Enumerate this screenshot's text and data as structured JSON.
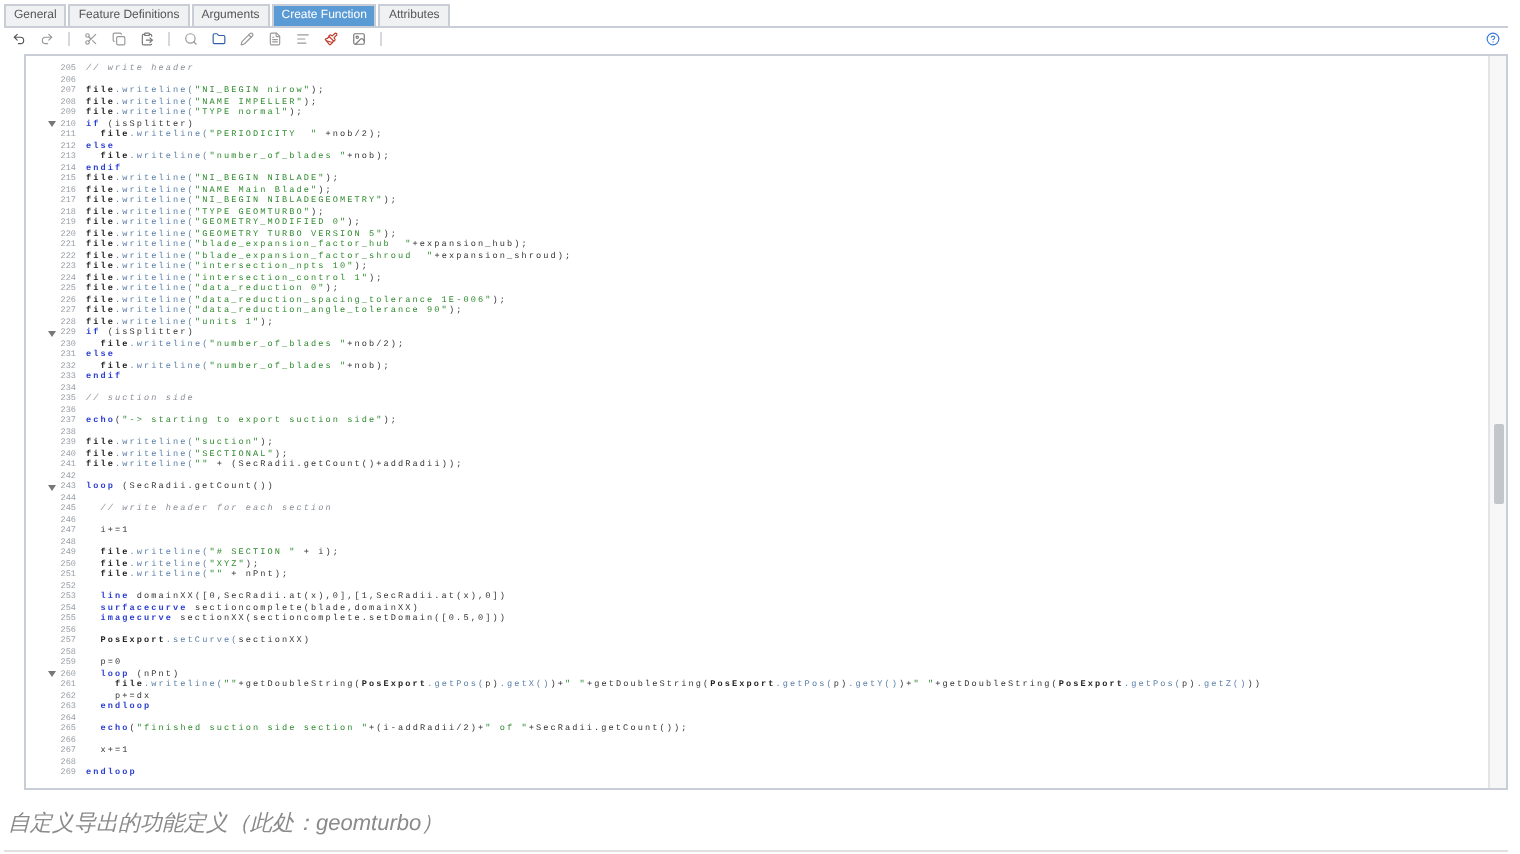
{
  "tabs": [
    {
      "label": "General",
      "selected": false
    },
    {
      "label": "Feature Definitions",
      "selected": false
    },
    {
      "label": "Arguments",
      "selected": false
    },
    {
      "label": "Create Function",
      "selected": true
    },
    {
      "label": "Attributes",
      "selected": false
    }
  ],
  "toolbar": [
    {
      "kind": "undo"
    },
    {
      "kind": "redo"
    },
    {
      "kind": "sep"
    },
    {
      "kind": "cut"
    },
    {
      "kind": "copy"
    },
    {
      "kind": "paste"
    },
    {
      "kind": "sep"
    },
    {
      "kind": "search"
    },
    {
      "kind": "folder"
    },
    {
      "kind": "pencil"
    },
    {
      "kind": "file"
    },
    {
      "kind": "list"
    },
    {
      "kind": "brush"
    },
    {
      "kind": "image"
    },
    {
      "kind": "sep"
    },
    {
      "kind": "help"
    }
  ],
  "editor": {
    "lines": [
      {
        "number": "205",
        "fold": false,
        "parts": [
          {
            "kind": "comment",
            "text": "// write header"
          }
        ]
      },
      {
        "number": "206",
        "fold": false
      },
      {
        "number": "207",
        "fold": false,
        "parts": [
          {
            "kind": "obj",
            "text": "file"
          },
          {
            "kind": "fn",
            "text": ".writeline("
          },
          {
            "kind": "str",
            "text": "\"NI_BEGIN nirow\""
          },
          {
            "kind": "plain",
            "text": ");"
          }
        ]
      },
      {
        "number": "208",
        "fold": false,
        "parts": [
          {
            "kind": "obj",
            "text": "file"
          },
          {
            "kind": "fn",
            "text": ".writeline("
          },
          {
            "kind": "str",
            "text": "\"NAME IMPELLER\""
          },
          {
            "kind": "plain",
            "text": ");"
          }
        ]
      },
      {
        "number": "209",
        "fold": false,
        "parts": [
          {
            "kind": "obj",
            "text": "file"
          },
          {
            "kind": "fn",
            "text": ".writeline("
          },
          {
            "kind": "str",
            "text": "\"TYPE normal\""
          },
          {
            "kind": "plain",
            "text": ");"
          }
        ]
      },
      {
        "number": "210",
        "fold": true,
        "parts": [
          {
            "kind": "kw",
            "text": "if"
          },
          {
            "kind": "plain",
            "text": " (isSplitter)"
          }
        ]
      },
      {
        "number": "211",
        "fold": false,
        "parts": [
          {
            "kind": "obj",
            "text": "  file"
          },
          {
            "kind": "fn",
            "text": ".writeline("
          },
          {
            "kind": "str",
            "text": "\"PERIODICITY  \""
          },
          {
            "kind": "plain",
            "text": " +nob/2);"
          }
        ]
      },
      {
        "number": "212",
        "fold": false,
        "parts": [
          {
            "kind": "kw",
            "text": "else"
          }
        ]
      },
      {
        "number": "213",
        "fold": false,
        "parts": [
          {
            "kind": "obj",
            "text": "  file"
          },
          {
            "kind": "fn",
            "text": ".writeline("
          },
          {
            "kind": "str",
            "text": "\"number_of_blades \""
          },
          {
            "kind": "plain",
            "text": "+nob);"
          }
        ]
      },
      {
        "number": "214",
        "fold": false,
        "parts": [
          {
            "kind": "kw",
            "text": "endif"
          }
        ]
      },
      {
        "number": "215",
        "fold": false,
        "parts": [
          {
            "kind": "obj",
            "text": "file"
          },
          {
            "kind": "fn",
            "text": ".writeline("
          },
          {
            "kind": "str",
            "text": "\"NI_BEGIN NIBLADE\""
          },
          {
            "kind": "plain",
            "text": ");"
          }
        ]
      },
      {
        "number": "216",
        "fold": false,
        "parts": [
          {
            "kind": "obj",
            "text": "file"
          },
          {
            "kind": "fn",
            "text": ".writeline("
          },
          {
            "kind": "str",
            "text": "\"NAME Main Blade\""
          },
          {
            "kind": "plain",
            "text": ");"
          }
        ]
      },
      {
        "number": "217",
        "fold": false,
        "parts": [
          {
            "kind": "obj",
            "text": "file"
          },
          {
            "kind": "fn",
            "text": ".writeline("
          },
          {
            "kind": "str",
            "text": "\"NI_BEGIN NIBLADEGEOMETRY\""
          },
          {
            "kind": "plain",
            "text": ");"
          }
        ]
      },
      {
        "number": "218",
        "fold": false,
        "parts": [
          {
            "kind": "obj",
            "text": "file"
          },
          {
            "kind": "fn",
            "text": ".writeline("
          },
          {
            "kind": "str",
            "text": "\"TYPE GEOMTURBO\""
          },
          {
            "kind": "plain",
            "text": ");"
          }
        ]
      },
      {
        "number": "219",
        "fold": false,
        "parts": [
          {
            "kind": "obj",
            "text": "file"
          },
          {
            "kind": "fn",
            "text": ".writeline("
          },
          {
            "kind": "str",
            "text": "\"GEOMETRY_MODIFIED 0\""
          },
          {
            "kind": "plain",
            "text": ");"
          }
        ]
      },
      {
        "number": "220",
        "fold": false,
        "parts": [
          {
            "kind": "obj",
            "text": "file"
          },
          {
            "kind": "fn",
            "text": ".writeline("
          },
          {
            "kind": "str",
            "text": "\"GEOMETRY TURBO VERSION 5\""
          },
          {
            "kind": "plain",
            "text": ");"
          }
        ]
      },
      {
        "number": "221",
        "fold": false,
        "parts": [
          {
            "kind": "obj",
            "text": "file"
          },
          {
            "kind": "fn",
            "text": ".writeline("
          },
          {
            "kind": "str",
            "text": "\"blade_expansion_factor_hub  \""
          },
          {
            "kind": "plain",
            "text": "+expansion_hub);"
          }
        ]
      },
      {
        "number": "222",
        "fold": false,
        "parts": [
          {
            "kind": "obj",
            "text": "file"
          },
          {
            "kind": "fn",
            "text": ".writeline("
          },
          {
            "kind": "str",
            "text": "\"blade_expansion_factor_shroud  \""
          },
          {
            "kind": "plain",
            "text": "+expansion_shroud);"
          }
        ]
      },
      {
        "number": "223",
        "fold": false,
        "parts": [
          {
            "kind": "obj",
            "text": "file"
          },
          {
            "kind": "fn",
            "text": ".writeline("
          },
          {
            "kind": "str",
            "text": "\"intersection_npts 10\""
          },
          {
            "kind": "plain",
            "text": ");"
          }
        ]
      },
      {
        "number": "224",
        "fold": false,
        "parts": [
          {
            "kind": "obj",
            "text": "file"
          },
          {
            "kind": "fn",
            "text": ".writeline("
          },
          {
            "kind": "str",
            "text": "\"intersection_control 1\""
          },
          {
            "kind": "plain",
            "text": ");"
          }
        ]
      },
      {
        "number": "225",
        "fold": false,
        "parts": [
          {
            "kind": "obj",
            "text": "file"
          },
          {
            "kind": "fn",
            "text": ".writeline("
          },
          {
            "kind": "str",
            "text": "\"data_reduction 0\""
          },
          {
            "kind": "plain",
            "text": ");"
          }
        ]
      },
      {
        "number": "226",
        "fold": false,
        "parts": [
          {
            "kind": "obj",
            "text": "file"
          },
          {
            "kind": "fn",
            "text": ".writeline("
          },
          {
            "kind": "str",
            "text": "\"data_reduction_spacing_tolerance 1E-006\""
          },
          {
            "kind": "plain",
            "text": ");"
          }
        ]
      },
      {
        "number": "227",
        "fold": false,
        "parts": [
          {
            "kind": "obj",
            "text": "file"
          },
          {
            "kind": "fn",
            "text": ".writeline("
          },
          {
            "kind": "str",
            "text": "\"data_reduction_angle_tolerance 90\""
          },
          {
            "kind": "plain",
            "text": ");"
          }
        ]
      },
      {
        "number": "228",
        "fold": false,
        "parts": [
          {
            "kind": "obj",
            "text": "file"
          },
          {
            "kind": "fn",
            "text": ".writeline("
          },
          {
            "kind": "str",
            "text": "\"units 1\""
          },
          {
            "kind": "plain",
            "text": ");"
          }
        ]
      },
      {
        "number": "229",
        "fold": true,
        "parts": [
          {
            "kind": "kw",
            "text": "if"
          },
          {
            "kind": "plain",
            "text": " (isSplitter)"
          }
        ]
      },
      {
        "number": "230",
        "fold": false,
        "parts": [
          {
            "kind": "obj",
            "text": "  file"
          },
          {
            "kind": "fn",
            "text": ".writeline("
          },
          {
            "kind": "str",
            "text": "\"number_of_blades \""
          },
          {
            "kind": "plain",
            "text": "+nob/2);"
          }
        ]
      },
      {
        "number": "231",
        "fold": false,
        "parts": [
          {
            "kind": "kw",
            "text": "else"
          }
        ]
      },
      {
        "number": "232",
        "fold": false,
        "parts": [
          {
            "kind": "obj",
            "text": "  file"
          },
          {
            "kind": "fn",
            "text": ".writeline("
          },
          {
            "kind": "str",
            "text": "\"number_of_blades \""
          },
          {
            "kind": "plain",
            "text": "+nob);"
          }
        ]
      },
      {
        "number": "233",
        "fold": false,
        "parts": [
          {
            "kind": "kw",
            "text": "endif"
          }
        ]
      },
      {
        "number": "234",
        "fold": false
      },
      {
        "number": "235",
        "fold": false,
        "parts": [
          {
            "kind": "comment",
            "text": "// suction side"
          }
        ]
      },
      {
        "number": "236",
        "fold": false
      },
      {
        "number": "237",
        "fold": false,
        "parts": [
          {
            "kind": "kw",
            "text": "echo"
          },
          {
            "kind": "plain",
            "text": "("
          },
          {
            "kind": "str",
            "text": "\"-> starting to export suction side\""
          },
          {
            "kind": "plain",
            "text": ");"
          }
        ]
      },
      {
        "number": "238",
        "fold": false
      },
      {
        "number": "239",
        "fold": false,
        "parts": [
          {
            "kind": "obj",
            "text": "file"
          },
          {
            "kind": "fn",
            "text": ".writeline("
          },
          {
            "kind": "str",
            "text": "\"suction\""
          },
          {
            "kind": "plain",
            "text": ");"
          }
        ]
      },
      {
        "number": "240",
        "fold": false,
        "parts": [
          {
            "kind": "obj",
            "text": "file"
          },
          {
            "kind": "fn",
            "text": ".writeline("
          },
          {
            "kind": "str",
            "text": "\"SECTIONAL\""
          },
          {
            "kind": "plain",
            "text": ");"
          }
        ]
      },
      {
        "number": "241",
        "fold": false,
        "parts": [
          {
            "kind": "obj",
            "text": "file"
          },
          {
            "kind": "fn",
            "text": ".writeline("
          },
          {
            "kind": "str",
            "text": "\"\""
          },
          {
            "kind": "plain",
            "text": " + (SecRadii.getCount()+addRadii));"
          }
        ]
      },
      {
        "number": "242",
        "fold": false
      },
      {
        "number": "243",
        "fold": true,
        "parts": [
          {
            "kind": "kw",
            "text": "loop"
          },
          {
            "kind": "plain",
            "text": " (SecRadii.getCount())"
          }
        ]
      },
      {
        "number": "244",
        "fold": false
      },
      {
        "number": "245",
        "fold": false,
        "parts": [
          {
            "kind": "comment",
            "text": "  // write header for each section"
          }
        ]
      },
      {
        "number": "246",
        "fold": false
      },
      {
        "number": "247",
        "fold": false,
        "parts": [
          {
            "kind": "plain",
            "text": "  i+=1"
          }
        ]
      },
      {
        "number": "248",
        "fold": false
      },
      {
        "number": "249",
        "fold": false,
        "parts": [
          {
            "kind": "obj",
            "text": "  file"
          },
          {
            "kind": "fn",
            "text": ".writeline("
          },
          {
            "kind": "str",
            "text": "\"# SECTION \""
          },
          {
            "kind": "plain",
            "text": " + i);"
          }
        ]
      },
      {
        "number": "250",
        "fold": false,
        "parts": [
          {
            "kind": "obj",
            "text": "  file"
          },
          {
            "kind": "fn",
            "text": ".writeline("
          },
          {
            "kind": "str",
            "text": "\"XYZ\""
          },
          {
            "kind": "plain",
            "text": ");"
          }
        ]
      },
      {
        "number": "251",
        "fold": false,
        "parts": [
          {
            "kind": "obj",
            "text": "  file"
          },
          {
            "kind": "fn",
            "text": ".writeline("
          },
          {
            "kind": "str",
            "text": "\"\""
          },
          {
            "kind": "plain",
            "text": " + nPnt);"
          }
        ]
      },
      {
        "number": "252",
        "fold": false
      },
      {
        "number": "253",
        "fold": false,
        "parts": [
          {
            "kind": "kw",
            "text": "  line"
          },
          {
            "kind": "plain",
            "text": " domainXX([0,SecRadii.at(x),0],[1,SecRadii.at(x),0])"
          }
        ]
      },
      {
        "number": "254",
        "fold": false,
        "parts": [
          {
            "kind": "kw",
            "text": "  surfacecurve"
          },
          {
            "kind": "plain",
            "text": " sectioncomplete(blade,domainXX)"
          }
        ]
      },
      {
        "number": "255",
        "fold": false,
        "parts": [
          {
            "kind": "kw",
            "text": "  imagecurve"
          },
          {
            "kind": "plain",
            "text": " sectionXX(sectioncomplete.setDomain([0.5,0]))"
          }
        ]
      },
      {
        "number": "256",
        "fold": false
      },
      {
        "number": "257",
        "fold": false,
        "parts": [
          {
            "kind": "obj",
            "text": "  PosExport"
          },
          {
            "kind": "fn",
            "text": ".setCurve("
          },
          {
            "kind": "plain",
            "text": "sectionXX)"
          }
        ]
      },
      {
        "number": "258",
        "fold": false
      },
      {
        "number": "259",
        "fold": false,
        "parts": [
          {
            "kind": "plain",
            "text": "  p=0"
          }
        ]
      },
      {
        "number": "260",
        "fold": true,
        "parts": [
          {
            "kind": "kw",
            "text": "  loop"
          },
          {
            "kind": "plain",
            "text": " (nPnt)"
          }
        ]
      },
      {
        "number": "261",
        "fold": false,
        "parts": [
          {
            "kind": "obj",
            "text": "    file"
          },
          {
            "kind": "fn",
            "text": ".writeline("
          },
          {
            "kind": "str",
            "text": "\"\""
          },
          {
            "kind": "plain",
            "text": "+getDoubleString("
          },
          {
            "kind": "obj",
            "text": "PosExport"
          },
          {
            "kind": "fn",
            "text": ".getPos("
          },
          {
            "kind": "plain",
            "text": "p)"
          },
          {
            "kind": "fn",
            "text": ".getX()"
          },
          {
            "kind": "plain",
            "text": ")+"
          },
          {
            "kind": "str",
            "text": "\" \""
          },
          {
            "kind": "plain",
            "text": "+getDoubleString("
          },
          {
            "kind": "obj",
            "text": "PosExport"
          },
          {
            "kind": "fn",
            "text": ".getPos("
          },
          {
            "kind": "plain",
            "text": "p)"
          },
          {
            "kind": "fn",
            "text": ".getY()"
          },
          {
            "kind": "plain",
            "text": ")+"
          },
          {
            "kind": "str",
            "text": "\" \""
          },
          {
            "kind": "plain",
            "text": "+getDoubleString("
          },
          {
            "kind": "obj",
            "text": "PosExport"
          },
          {
            "kind": "fn",
            "text": ".getPos("
          },
          {
            "kind": "plain",
            "text": "p)"
          },
          {
            "kind": "fn",
            "text": ".getZ()"
          },
          {
            "kind": "plain",
            "text": "))"
          }
        ]
      },
      {
        "number": "262",
        "fold": false,
        "parts": [
          {
            "kind": "plain",
            "text": "    p+=dx"
          }
        ]
      },
      {
        "number": "263",
        "fold": false,
        "parts": [
          {
            "kind": "kw",
            "text": "  endloop"
          }
        ]
      },
      {
        "number": "264",
        "fold": false
      },
      {
        "number": "265",
        "fold": false,
        "parts": [
          {
            "kind": "kw",
            "text": "  echo"
          },
          {
            "kind": "plain",
            "text": "("
          },
          {
            "kind": "str",
            "text": "\"finished suction side section \""
          },
          {
            "kind": "plain",
            "text": "+(i-addRadii/2)+"
          },
          {
            "kind": "str",
            "text": "\" of \""
          },
          {
            "kind": "plain",
            "text": "+SecRadii.getCount());"
          }
        ]
      },
      {
        "number": "266",
        "fold": false
      },
      {
        "number": "267",
        "fold": false,
        "parts": [
          {
            "kind": "plain",
            "text": "  x+=1"
          }
        ]
      },
      {
        "number": "268",
        "fold": false
      },
      {
        "number": "269",
        "fold": false,
        "parts": [
          {
            "kind": "kw",
            "text": "endloop"
          }
        ]
      }
    ]
  },
  "caption": "自定义导出的功能定义（此处：geomturbo）"
}
